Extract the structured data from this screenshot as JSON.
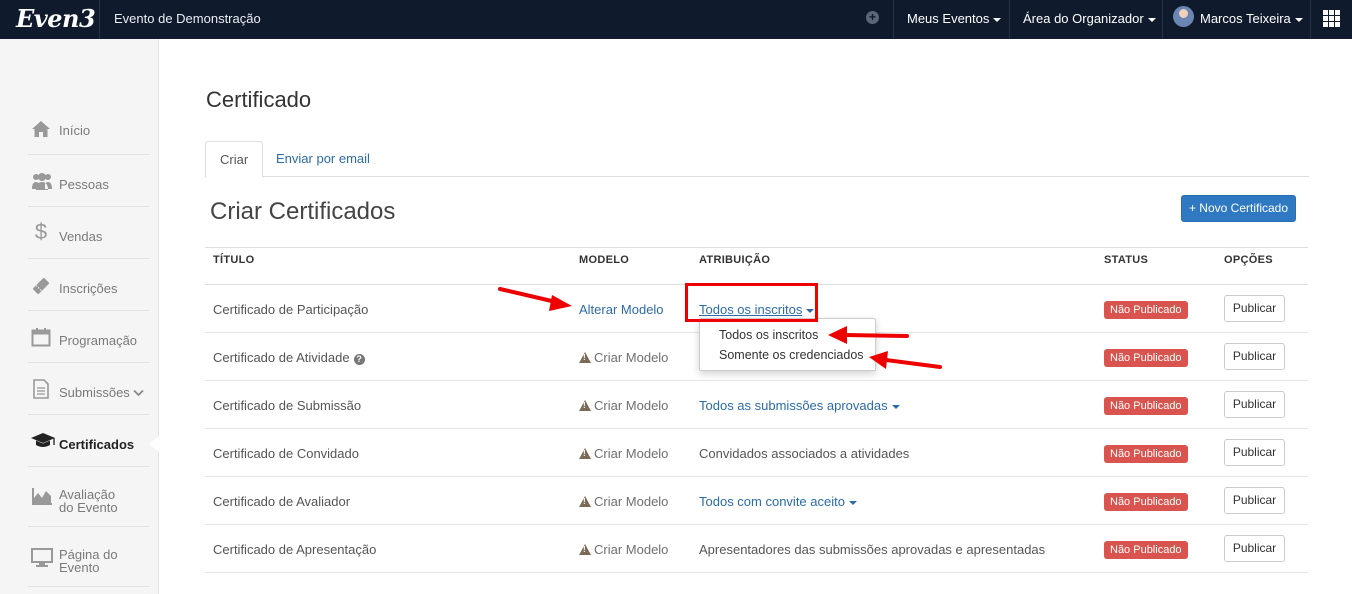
{
  "topbar": {
    "logo": "Even3",
    "event_name": "Evento de Demonstração",
    "my_events": "Meus Eventos",
    "organizer_area": "Área do Organizador",
    "user_name": "Marcos Teixeira",
    "bg_color": "#0f1b2d"
  },
  "sidebar": {
    "items": [
      {
        "label": "Início",
        "icon": "home-icon"
      },
      {
        "label": "Pessoas",
        "icon": "users-icon"
      },
      {
        "label": "Vendas",
        "icon": "dollar-icon"
      },
      {
        "label": "Inscrições",
        "icon": "ticket-icon"
      },
      {
        "label": "Programação",
        "icon": "calendar-icon"
      },
      {
        "label": "Submissões",
        "icon": "document-icon"
      },
      {
        "label": "Certificados",
        "icon": "graduation-cap-icon"
      },
      {
        "label_1": "Avaliação",
        "label_2": "do Evento",
        "icon": "area-chart-icon"
      },
      {
        "label_1": "Página do",
        "label_2": "Evento",
        "icon": "monitor-icon"
      }
    ]
  },
  "page": {
    "title": "Certificado",
    "tabs": [
      {
        "label": "Criar"
      },
      {
        "label": "Enviar por email"
      }
    ],
    "section_title": "Criar Certificados",
    "new_button": "+ Novo Certificado"
  },
  "table": {
    "headers": [
      "TÍTULO",
      "MODELO",
      "ATRIBUIÇÃO",
      "STATUS",
      "OPÇÕES"
    ],
    "rows": [
      {
        "title": "Certificado de Participação",
        "model": "Alterar Modelo",
        "attribution": "Todos os inscritos",
        "status": "Não Publicado",
        "action": "Publicar"
      },
      {
        "title": "Certificado de Atividade",
        "model": "Criar Modelo",
        "attribution": "",
        "status": "Não Publicado",
        "action": "Publicar"
      },
      {
        "title": "Certificado de Submissão",
        "model": "Criar Modelo",
        "attribution": "Todos as submissões aprovadas",
        "status": "Não Publicado",
        "action": "Publicar"
      },
      {
        "title": "Certificado de Convidado",
        "model": "Criar Modelo",
        "attribution": "Convidados associados a atividades",
        "status": "Não Publicado",
        "action": "Publicar"
      },
      {
        "title": "Certificado de Avaliador",
        "model": "Criar Modelo",
        "attribution": "Todos com convite aceito",
        "status": "Não Publicado",
        "action": "Publicar"
      },
      {
        "title": "Certificado de Apresentação",
        "model": "Criar Modelo",
        "attribution": "Apresentadores das submissões aprovadas e apresentadas",
        "status": "Não Publicado",
        "action": "Publicar"
      }
    ]
  },
  "dropdown": {
    "options": [
      "Todos os inscritos",
      "Somente os credenciados"
    ]
  },
  "colors": {
    "accent": "#2f79c3",
    "danger": "#d9534f",
    "annotation": "#e00000"
  }
}
